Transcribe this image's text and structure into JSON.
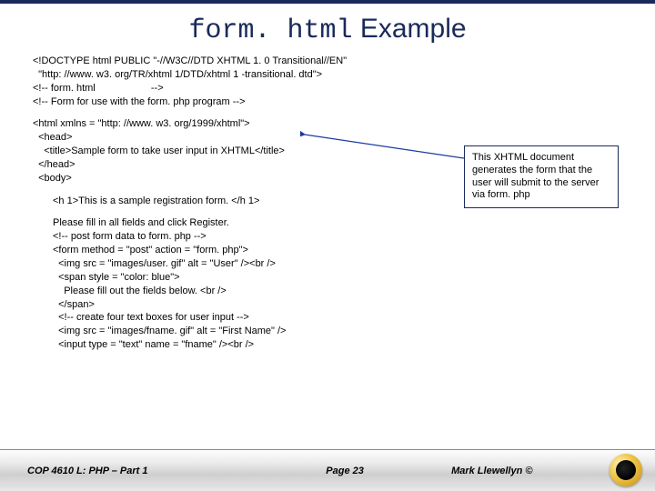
{
  "title_code": "form. html",
  "title_suffix": " Example",
  "code": {
    "l1": "<!DOCTYPE html PUBLIC \"-//W3C//DTD XHTML 1. 0 Transitional//EN\"",
    "l2": "  \"http: //www. w3. org/TR/xhtml 1/DTD/xhtml 1 -transitional. dtd\">",
    "l3": "<!-- form. html                    -->",
    "l4": "<!-- Form for use with the form. php program -->",
    "l5": "<html xmlns = \"http: //www. w3. org/1999/xhtml\">",
    "l6": "  <head>",
    "l7": "    <title>Sample form to take user input in XHTML</title>",
    "l8": "  </head>",
    "l9": "  <body>",
    "l10": "<h 1>This is a sample registration form. </h 1>",
    "l11": "Please fill in all fields and click Register.",
    "l12": "<!-- post form data to form. php -->",
    "l13": "<form method = \"post\" action = \"form. php\">",
    "l14": "  <img src = \"images/user. gif\" alt = \"User\" /><br />",
    "l15": "  <span style = \"color: blue\">",
    "l16": "    Please fill out the fields below. <br />",
    "l17": "  </span>",
    "l18": "  <!-- create four text boxes for user input -->",
    "l19": "  <img src = \"images/fname. gif\" alt = \"First Name\" />",
    "l20": "  <input type = \"text\" name = \"fname\" /><br />"
  },
  "callout": "This XHTML document generates the form that the user will submit to the server via form. php",
  "footer": {
    "course": "COP 4610 L:  PHP – Part 1",
    "page": "Page 23",
    "author": "Mark Llewellyn ©"
  }
}
